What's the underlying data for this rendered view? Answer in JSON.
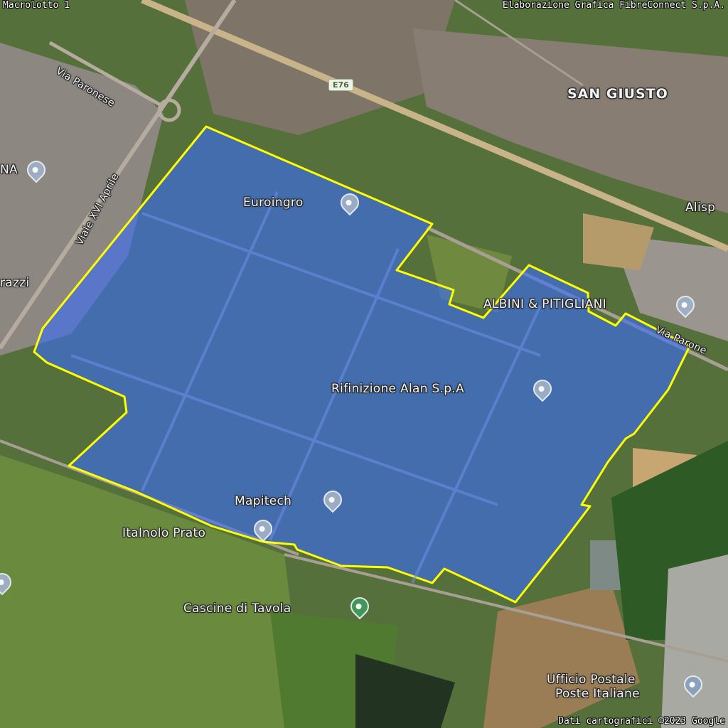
{
  "header": {
    "title": "Macrolotto 1",
    "credit": "Elaborazione Grafica FibreConnect S.p.A."
  },
  "footer": {
    "attribution": "Dati cartografici ©2023 Google"
  },
  "road_shield": "E76",
  "places": {
    "san_giusto": "SAN GIUSTO",
    "alisp": "Alisp",
    "na": "NA",
    "razzi": "razzi",
    "euroingro": "Euroingro",
    "albini": "ALBINI & PITIGLIANI",
    "rifinizione": "Rifinizione Alan S.p.A",
    "mapitech": "Mapitech",
    "italnolo": "Italnolo Prato",
    "cascine": "Cascine di Tavola",
    "ufficio_line1": "Ufficio Postale",
    "ufficio_line2": "Poste Italiane"
  },
  "roads": {
    "via_paronese_nw": "Via Paronese",
    "viale_xvi_aprile": "Viale XVI Aprile",
    "via_paronese_e": "Via Parone"
  },
  "highlight": {
    "name": "Macrolotto 1",
    "fill": "#3a6cf4",
    "stroke": "#ffff00"
  },
  "colors": {
    "field_green": "#5b7a3a",
    "dark_field": "#2f4a25",
    "urban": "#8a7e73",
    "road_beige": "#c9b48a"
  }
}
